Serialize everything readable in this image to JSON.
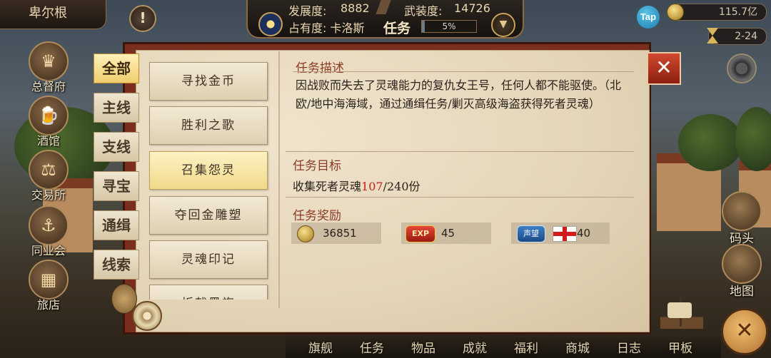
{
  "location": "卑尔根",
  "stats": {
    "development_label": "发展度:",
    "development_value": "8882",
    "armament_label": "武装度:",
    "armament_value": "14726",
    "occupancy_text": "占有度: 卡洛斯",
    "panel_title": "任务",
    "progress_text": "5%",
    "progress_fraction": 0.05
  },
  "top_right": {
    "tap_label": "Tap",
    "gold_amount": "115.7亿",
    "date": "2-24"
  },
  "left_nav": [
    {
      "label": "总督府",
      "icon": "crown-icon"
    },
    {
      "label": "酒馆",
      "icon": "beer-mug-icon"
    },
    {
      "label": "交易所",
      "icon": "scales-icon"
    },
    {
      "label": "同业会",
      "icon": "shield-anchor-icon"
    },
    {
      "label": "旅店",
      "icon": "basket-icon"
    }
  ],
  "categories": [
    {
      "label": "全部",
      "active": true
    },
    {
      "label": "主线",
      "active": false
    },
    {
      "label": "支线",
      "active": false
    },
    {
      "label": "寻宝",
      "active": false
    },
    {
      "label": "通缉",
      "active": false
    },
    {
      "label": "线索",
      "active": false
    }
  ],
  "quests": [
    {
      "label": "寻找金币",
      "active": false
    },
    {
      "label": "胜利之歌",
      "active": false
    },
    {
      "label": "召集怨灵",
      "active": true
    },
    {
      "label": "夺回金雕塑",
      "active": false
    },
    {
      "label": "灵魂印记",
      "active": false
    },
    {
      "label": "折戟黑旗",
      "active": false
    }
  ],
  "detail": {
    "desc_title": "任务描述",
    "desc_text": "因战败而失去了灵魂能力的复仇女王号，任何人都不能驱使。（北欧/地中海海域，通过通缉任务/剿灭高级海盗获得死者灵魂）",
    "goal_title": "任务目标",
    "goal_prefix": "收集死者灵魂",
    "goal_current": "107",
    "goal_suffix": "/240份",
    "reward_title": "任务奖励",
    "rewards": {
      "gold": "36851",
      "exp_badge": "EXP",
      "exp": "45",
      "reputation_badge": "声望",
      "reputation": "40"
    }
  },
  "right_side": [
    {
      "label": "码头",
      "icon": "dock-icon"
    },
    {
      "label": "地图",
      "icon": "map-scroll-icon"
    }
  ],
  "bottom_menu": [
    "旗舰",
    "任务",
    "物品",
    "成就",
    "福利",
    "商城",
    "日志",
    "甲板"
  ],
  "colors": {
    "accent_red": "#c8201a",
    "section_title": "#8b3a24",
    "panel_frame": "#7b2e1e"
  }
}
